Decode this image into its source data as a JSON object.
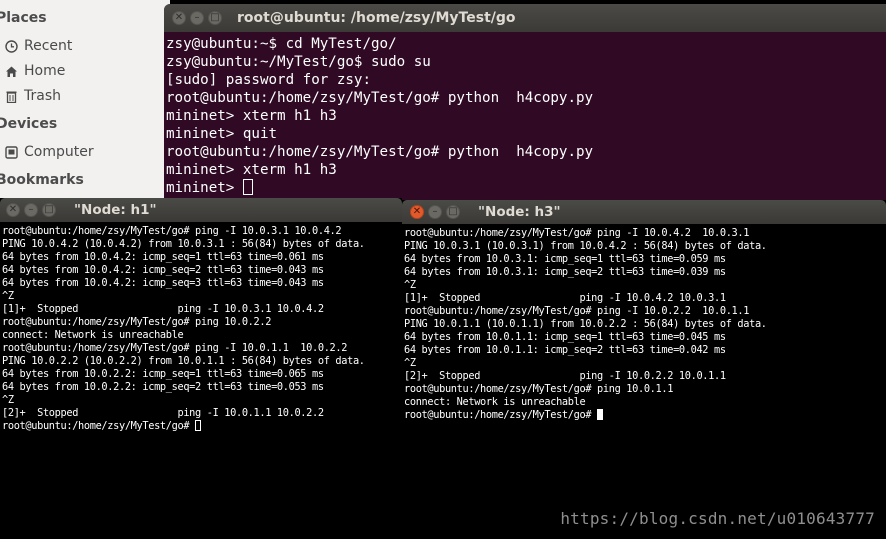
{
  "places": {
    "header_places": "Places",
    "recent": "Recent",
    "home": "Home",
    "trash": "Trash",
    "header_devices": "Devices",
    "computer": "Computer",
    "header_bookmarks": "Bookmarks"
  },
  "top_terminal": {
    "title": "root@ubuntu: /home/zsy/MyTest/go",
    "lines": [
      "zsy@ubuntu:~$ cd MyTest/go/",
      "zsy@ubuntu:~/MyTest/go$ sudo su",
      "[sudo] password for zsy:",
      "root@ubuntu:/home/zsy/MyTest/go# python  h4copy.py",
      "mininet> xterm h1 h3",
      "mininet> quit",
      "root@ubuntu:/home/zsy/MyTest/go# python  h4copy.py",
      "mininet> xterm h1 h3"
    ],
    "prompt": "mininet> "
  },
  "h1": {
    "title": "\"Node: h1\"",
    "lines": [
      "root@ubuntu:/home/zsy/MyTest/go# ping -I 10.0.3.1 10.0.4.2",
      "PING 10.0.4.2 (10.0.4.2) from 10.0.3.1 : 56(84) bytes of data.",
      "64 bytes from 10.0.4.2: icmp_seq=1 ttl=63 time=0.061 ms",
      "64 bytes from 10.0.4.2: icmp_seq=2 ttl=63 time=0.043 ms",
      "64 bytes from 10.0.4.2: icmp_seq=3 ttl=63 time=0.043 ms",
      "^Z",
      "[1]+  Stopped                 ping -I 10.0.3.1 10.0.4.2",
      "root@ubuntu:/home/zsy/MyTest/go# ping 10.0.2.2",
      "connect: Network is unreachable",
      "root@ubuntu:/home/zsy/MyTest/go# ping -I 10.0.1.1  10.0.2.2",
      "PING 10.0.2.2 (10.0.2.2) from 10.0.1.1 : 56(84) bytes of data.",
      "64 bytes from 10.0.2.2: icmp_seq=1 ttl=63 time=0.065 ms",
      "64 bytes from 10.0.2.2: icmp_seq=2 ttl=63 time=0.053 ms",
      "^Z",
      "[2]+  Stopped                 ping -I 10.0.1.1 10.0.2.2"
    ],
    "prompt": "root@ubuntu:/home/zsy/MyTest/go# "
  },
  "h3": {
    "title": "\"Node: h3\"",
    "lines": [
      "root@ubuntu:/home/zsy/MyTest/go# ping -I 10.0.4.2  10.0.3.1",
      "PING 10.0.3.1 (10.0.3.1) from 10.0.4.2 : 56(84) bytes of data.",
      "64 bytes from 10.0.3.1: icmp_seq=1 ttl=63 time=0.059 ms",
      "64 bytes from 10.0.3.1: icmp_seq=2 ttl=63 time=0.039 ms",
      "^Z",
      "[1]+  Stopped                 ping -I 10.0.4.2 10.0.3.1",
      "root@ubuntu:/home/zsy/MyTest/go# ping -I 10.0.2.2  10.0.1.1",
      "PING 10.0.1.1 (10.0.1.1) from 10.0.2.2 : 56(84) bytes of data.",
      "64 bytes from 10.0.1.1: icmp_seq=1 ttl=63 time=0.045 ms",
      "64 bytes from 10.0.1.1: icmp_seq=2 ttl=63 time=0.042 ms",
      "^Z",
      "[2]+  Stopped                 ping -I 10.0.2.2 10.0.1.1",
      "root@ubuntu:/home/zsy/MyTest/go# ping 10.0.1.1",
      "connect: Network is unreachable"
    ],
    "prompt": "root@ubuntu:/home/zsy/MyTest/go# "
  },
  "watermark": "https://blog.csdn.net/u010643777",
  "colors": {
    "terminal_bg": "#300a24",
    "close_button": "#e25a2b",
    "titlebar": "#3c3b37"
  }
}
